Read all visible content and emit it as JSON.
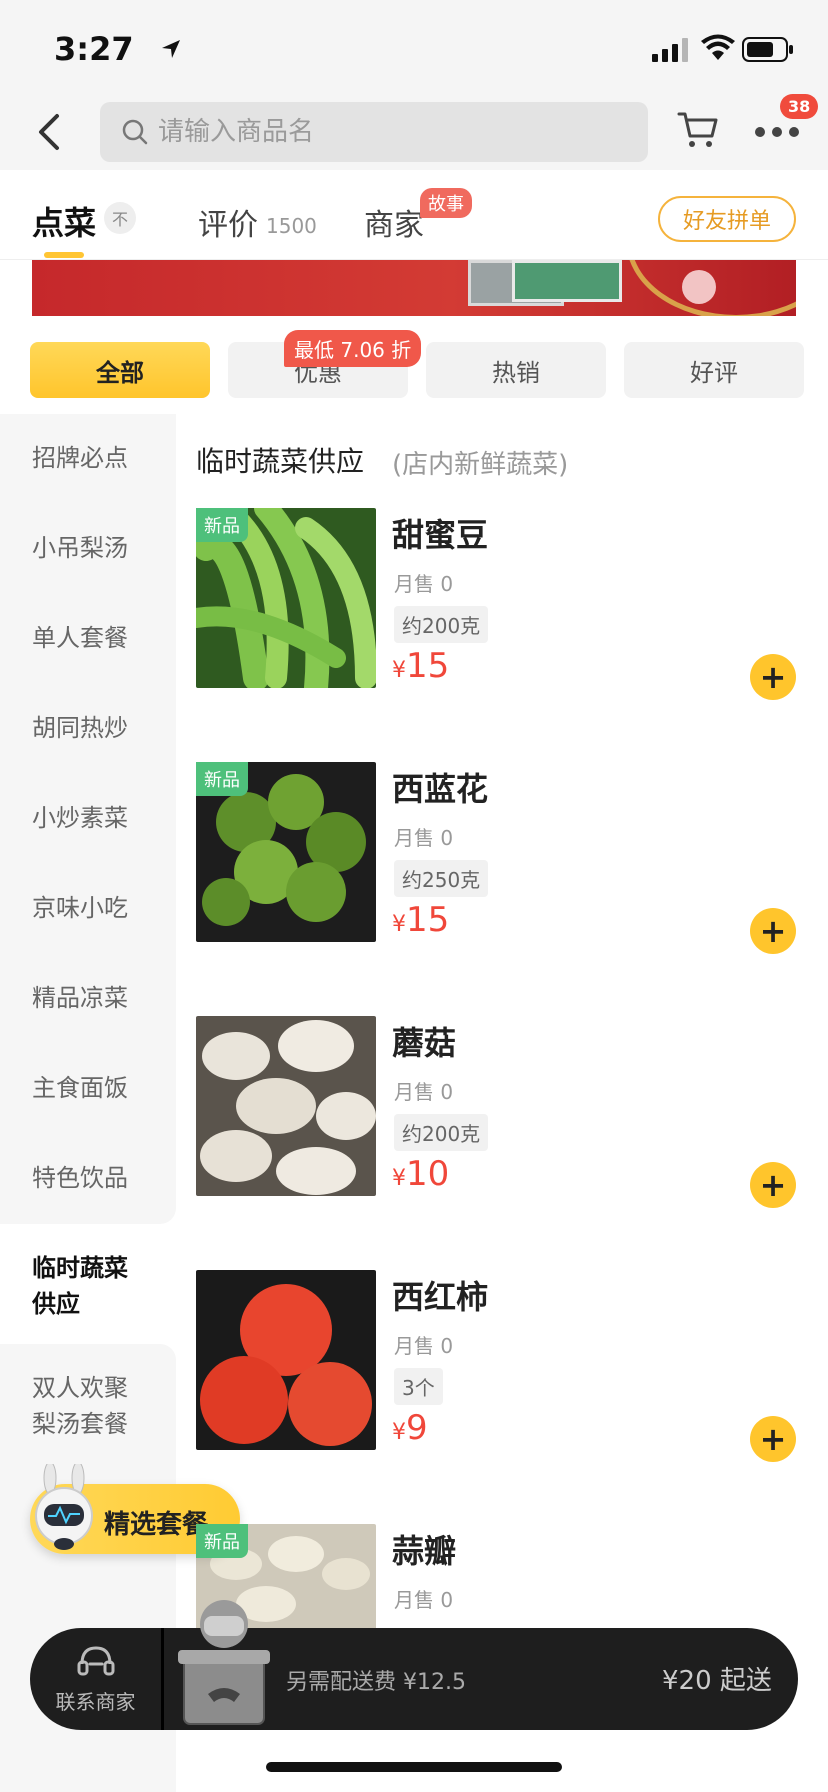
{
  "status_bar": {
    "time": "3:27"
  },
  "header": {
    "search_placeholder": "请输入商品名",
    "more_badge": "38"
  },
  "tabs": {
    "order": "点菜",
    "order_collapse_icon": "不",
    "review": "评价",
    "review_count": "1500",
    "merchant": "商家",
    "merchant_badge": "故事",
    "group_order": "好友拼单"
  },
  "filters": {
    "chips": [
      "全部",
      "优惠",
      "热销",
      "好评"
    ],
    "active": "全部",
    "discount_badge": "最低 7.06 折"
  },
  "sidebar": {
    "items": [
      "招牌必点",
      "小吊梨汤",
      "单人套餐",
      "胡同热炒",
      "小炒素菜",
      "京味小吃",
      "精品凉菜",
      "主食面饭",
      "特色饮品",
      "临时蔬菜\n供应",
      "双人欢聚\n梨汤套餐"
    ],
    "active_index": 9
  },
  "section": {
    "title": "临时蔬菜供应",
    "subtitle": "(店内新鲜蔬菜)"
  },
  "items": [
    {
      "name": "甜蜜豆",
      "sales": "月售 0",
      "spec": "约200克",
      "currency": "¥",
      "price": "15",
      "new_tag": "新品"
    },
    {
      "name": "西蓝花",
      "sales": "月售 0",
      "spec": "约250克",
      "currency": "¥",
      "price": "15",
      "new_tag": "新品"
    },
    {
      "name": "蘑菇",
      "sales": "月售 0",
      "spec": "约200克",
      "currency": "¥",
      "price": "10",
      "new_tag": ""
    },
    {
      "name": "西红柿",
      "sales": "月售 0",
      "spec": "3个",
      "currency": "¥",
      "price": "9",
      "new_tag": ""
    },
    {
      "name": "蒜瓣",
      "sales": "月售 0",
      "spec": "",
      "currency": "",
      "price": "",
      "new_tag": "新品"
    }
  ],
  "combo_float": {
    "label": "精选套餐"
  },
  "bottom_bar": {
    "contact": "联系商家",
    "delivery_fee": "另需配送费 ¥12.5",
    "min_order": "¥20 起送"
  },
  "colors": {
    "accent_yellow": "#ffc52c",
    "price_red": "#f0473a",
    "new_tag_green": "#4ec07b",
    "group_order_orange": "#e69b23"
  },
  "icons": {
    "back": "chevron-left-icon",
    "search": "search-icon",
    "cart": "cart-icon",
    "more": "more-dots-icon",
    "add": "plus-icon",
    "contact": "headset-icon"
  }
}
